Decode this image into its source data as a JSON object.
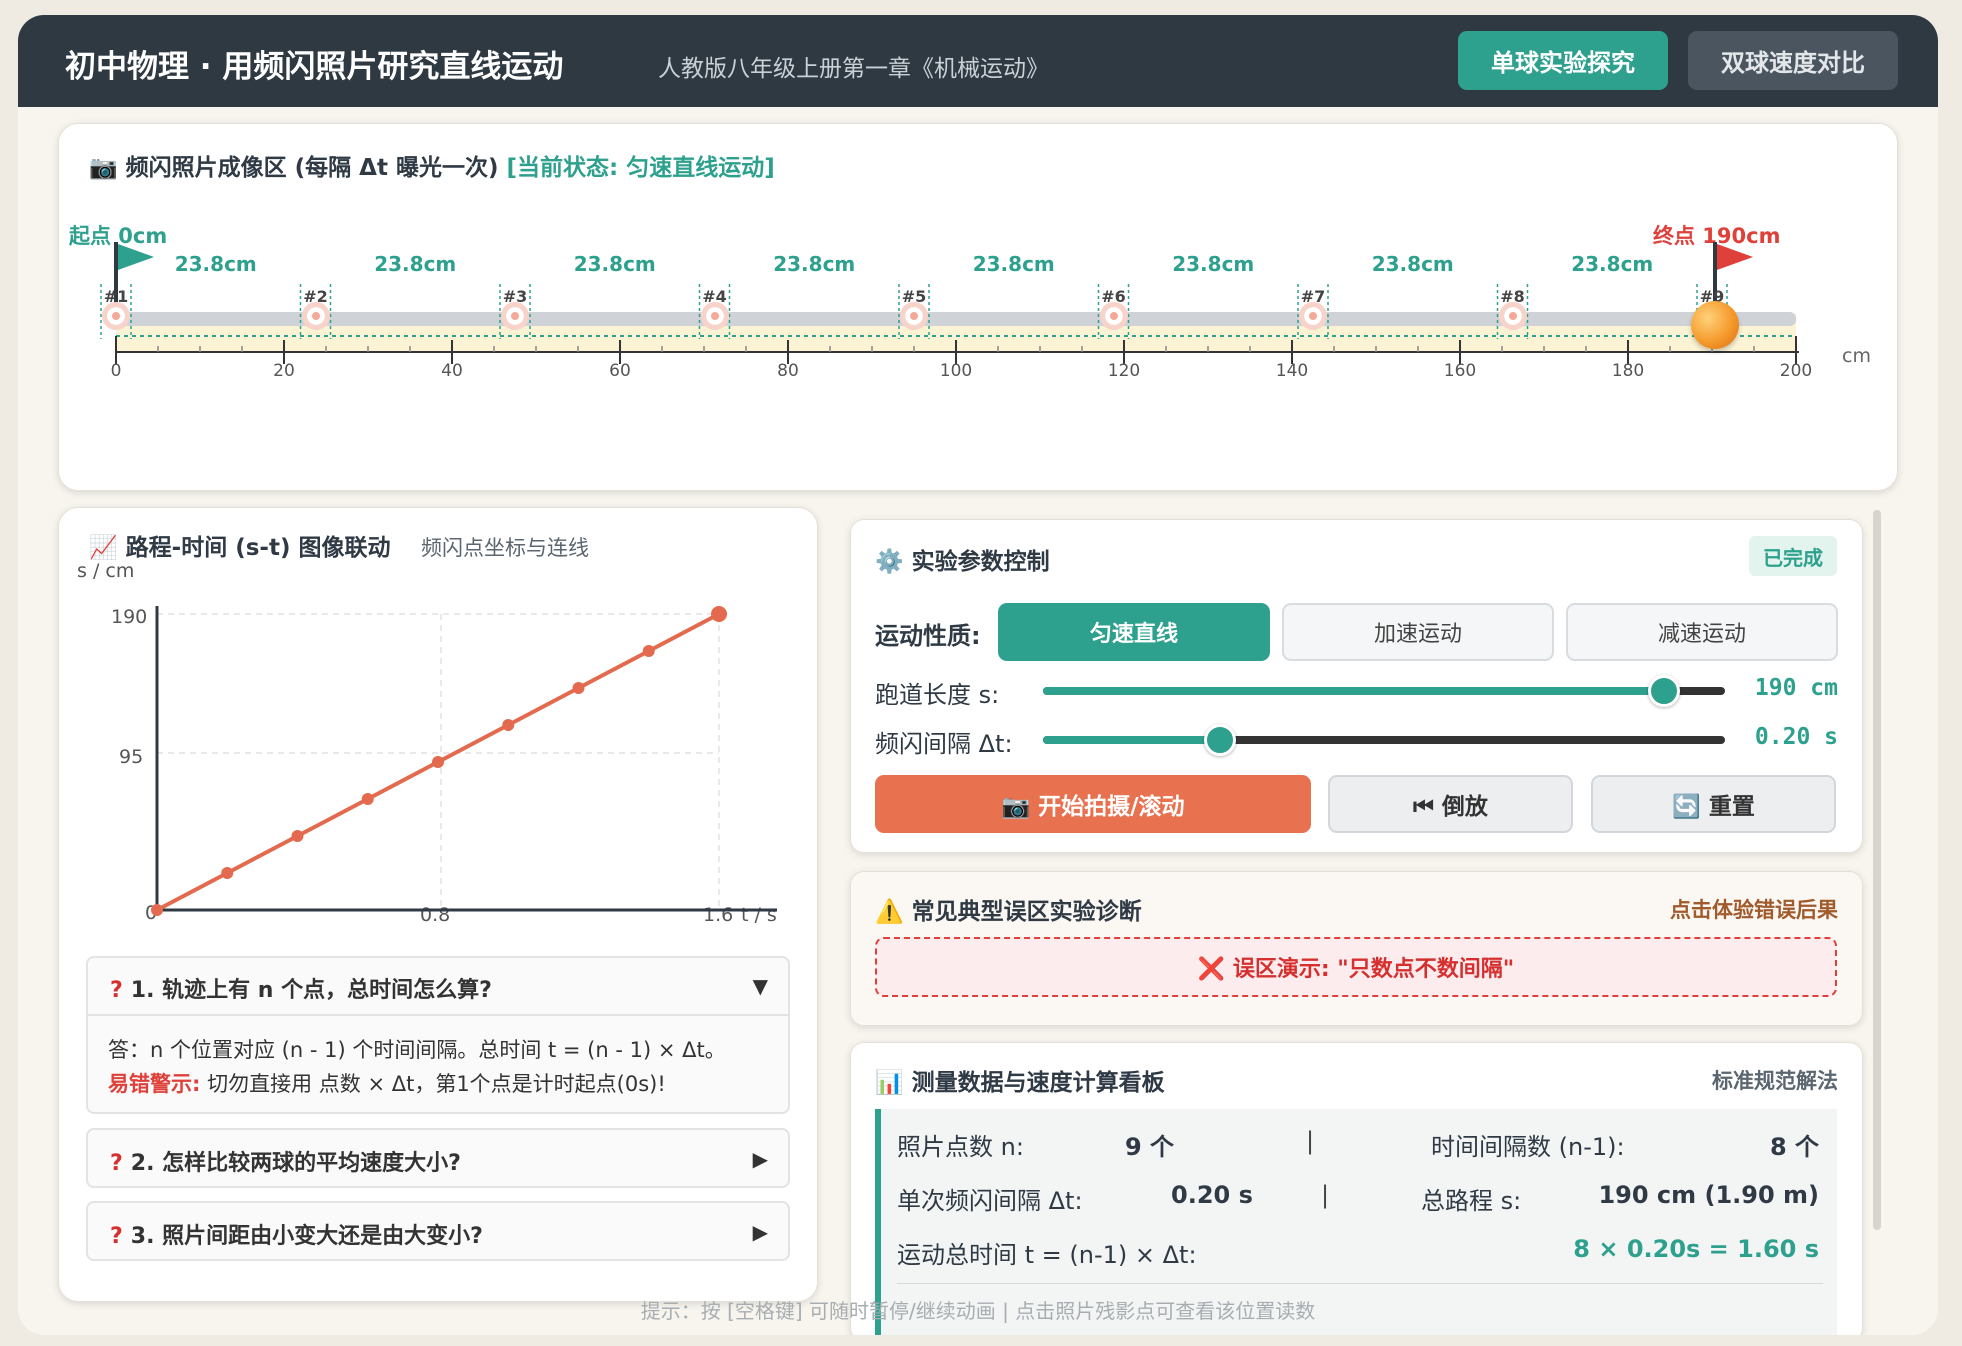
{
  "header": {
    "title": "初中物理 · 用频闪照片研究直线运动",
    "subtitle": "人教版八年级上册第一章《机械运动》",
    "tab_single": "单球实验探究",
    "tab_compare": "双球速度对比"
  },
  "flash": {
    "title": "📷 频闪照片成像区 (每隔 Δt 曝光一次)",
    "status": "[当前状态: 匀速直线运动]",
    "start_label": "起点 0cm",
    "end_label": "终点 190cm",
    "unit": "cm",
    "segments": [
      "23.8cm",
      "23.8cm",
      "23.8cm",
      "23.8cm",
      "23.8cm",
      "23.8cm",
      "23.8cm",
      "23.8cm"
    ],
    "points": [
      "#1",
      "#2",
      "#3",
      "#4",
      "#5",
      "#6",
      "#7",
      "#8",
      "#9"
    ],
    "ticks": [
      "0",
      "20",
      "40",
      "60",
      "80",
      "100",
      "120",
      "140",
      "160",
      "180",
      "200"
    ],
    "colors": {
      "accent": "#2ea08e",
      "end_flag": "#e0403a",
      "ball": "#f59a2c"
    }
  },
  "chart": {
    "title": "📈 路程-时间 (s-t) 图像联动",
    "subtitle": "频闪点坐标与连线",
    "ylabel": "s / cm",
    "xlabel": "t / s",
    "ytick_top": "190",
    "ytick_mid": "95",
    "xtick_0": "0",
    "xtick_mid": "0.8",
    "xtick_end": "1.6"
  },
  "chart_data": {
    "type": "line",
    "x": [
      0,
      0.2,
      0.4,
      0.6,
      0.8,
      1.0,
      1.2,
      1.4,
      1.6
    ],
    "y": [
      0,
      23.75,
      47.5,
      71.25,
      95,
      118.75,
      142.5,
      166.25,
      190
    ],
    "xlabel": "t / s",
    "ylabel": "s / cm",
    "xlim": [
      0,
      1.6
    ],
    "ylim": [
      0,
      190
    ],
    "grid": true,
    "color": "#e36a4e"
  },
  "faq": [
    {
      "q": "1. 轨迹上有 n 个点，总时间怎么算?",
      "arrow": "▼",
      "a1": "答：n 个位置对应 (n - 1) 个时间间隔。总时间 t = (n - 1) × Δt。",
      "a2_warn": "易错警示:",
      "a2": "切勿直接用 点数 × Δt，第1个点是计时起点(0s)!"
    },
    {
      "q": "2. 怎样比较两球的平均速度大小?",
      "arrow": "▶"
    },
    {
      "q": "3. 照片间距由小变大还是由大变小?",
      "arrow": "▶"
    }
  ],
  "controls": {
    "title": "⚙️ 实验参数控制",
    "badge": "已完成",
    "motion_label": "运动性质:",
    "modes": [
      "匀速直线",
      "加速运动",
      "减速运动"
    ],
    "length_label": "跑道长度 s:",
    "length_value": "190 cm",
    "length_fraction": 0.91,
    "interval_label": "频闪间隔 Δt:",
    "interval_value": "0.20 s",
    "interval_fraction": 0.26,
    "btn_start": "📷 开始拍摄/滚动",
    "btn_rewind": "⏮ 倒放",
    "btn_reset": "🔄 重置"
  },
  "pitfall": {
    "title": "⚠️ 常见典型误区实验诊断",
    "link": "点击体验错误后果",
    "demo": "❌ 误区演示: \"只数点不数间隔\""
  },
  "data": {
    "title": "📊 测量数据与速度计算看板",
    "link": "标准规范解法",
    "n_label": "照片点数 n:",
    "n_value": "9 个",
    "intervals_label": "时间间隔数 (n-1):",
    "intervals_value": "8 个",
    "dt_label": "单次频闪间隔 Δt:",
    "dt_value": "0.20 s",
    "s_label": "总路程 s:",
    "s_value": "190 cm (1.90 m)",
    "t_label": "运动总时间 t = (n-1) × Δt:",
    "t_value": "8 × 0.20s = 1.60 s",
    "sep": "|"
  },
  "footer": "提示：按 [空格键] 可随时暂停/继续动画 | 点击照片残影点可查看该位置读数"
}
